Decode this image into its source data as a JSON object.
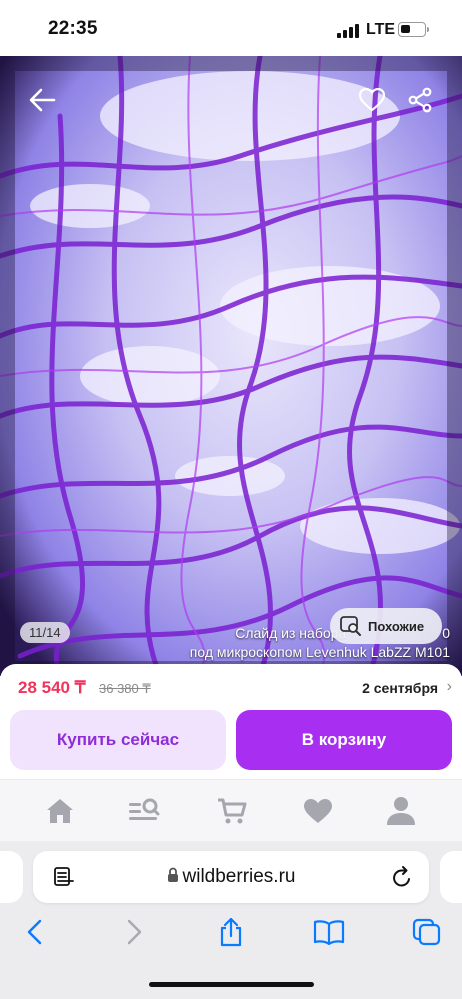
{
  "status_bar": {
    "time": "22:35",
    "network": "LTE",
    "battery_level": 0.45
  },
  "photo": {
    "counter": "11/14",
    "similar_label": "Похожие",
    "caption_line1": "Слайд из набора",
    "caption_line1_end": "0",
    "caption_line2": "под микроскопом Levenhuk LabZZ M101"
  },
  "icons": {
    "back": "arrow-left-icon",
    "favorite": "heart-icon",
    "share": "share-icon",
    "similar": "image-search-icon"
  },
  "product": {
    "price": "28 540 ₸",
    "old_price": "36 380 ₸",
    "delivery_date": "2 сентября",
    "buy_now_label": "Купить сейчас",
    "add_to_cart_label": "В корзину"
  },
  "tabbar": [
    "home-icon",
    "catalog-search-icon",
    "cart-icon",
    "favorites-icon",
    "profile-icon"
  ],
  "browser": {
    "url": "wildberries.ru"
  },
  "colors": {
    "accent": "#a82ff1",
    "price": "#f0335a",
    "ios_blue": "#0a7aff"
  }
}
